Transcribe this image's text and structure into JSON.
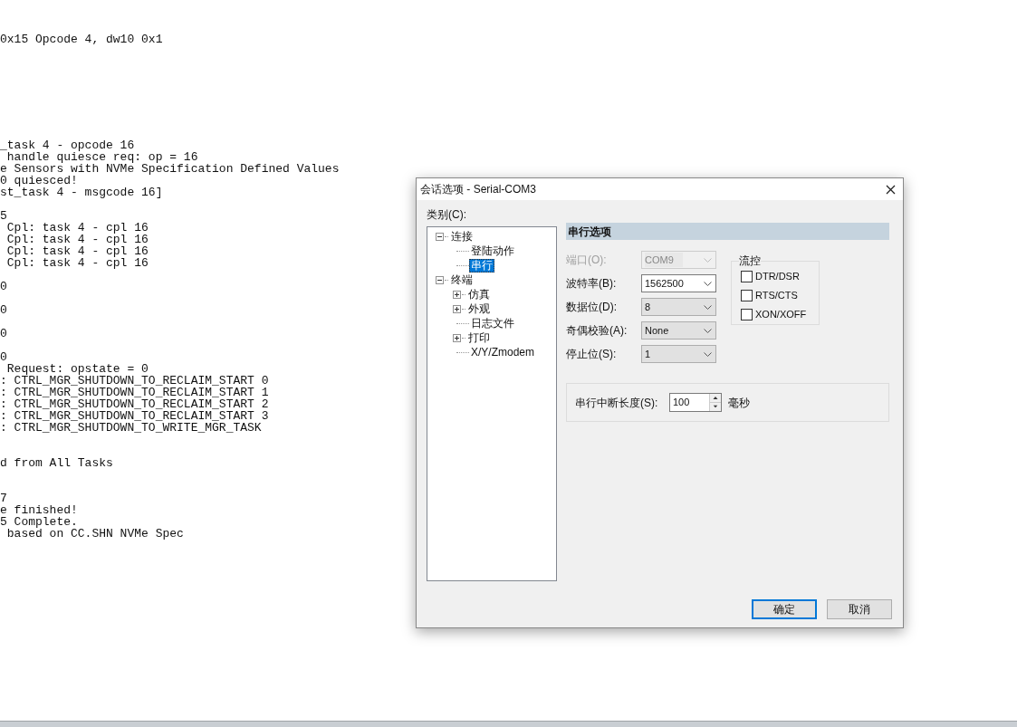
{
  "terminal": {
    "blocks": [
      {
        "lines": [
          "0x15 Opcode 4, dw10 0x1"
        ]
      },
      {
        "lines": [
          "_task 4 - opcode 16",
          " handle quiesce req: op = 16",
          "e Sensors with NVMe Specification Defined Values",
          "0 quiesced!",
          "st_task 4 - msgcode 16]"
        ]
      },
      {
        "lines": [
          "5",
          " Cpl: task 4 - cpl 16",
          " Cpl: task 4 - cpl 16",
          " Cpl: task 4 - cpl 16",
          " Cpl: task 4 - cpl 16"
        ]
      },
      {
        "lines": [
          "0"
        ]
      },
      {
        "lines": [
          "0"
        ]
      },
      {
        "lines": [
          "0"
        ]
      },
      {
        "lines": [
          "0",
          " Request: opstate = 0",
          ": CTRL_MGR_SHUTDOWN_TO_RECLAIM_START 0",
          ": CTRL_MGR_SHUTDOWN_TO_RECLAIM_START 1",
          ": CTRL_MGR_SHUTDOWN_TO_RECLAIM_START 2",
          ": CTRL_MGR_SHUTDOWN_TO_RECLAIM_START 3",
          ": CTRL_MGR_SHUTDOWN_TO_WRITE_MGR_TASK"
        ]
      },
      {
        "lines": [
          "d from All Tasks"
        ]
      },
      {
        "lines": [
          "7",
          "e finished!",
          "5 Complete.",
          " based on CC.SHN NVMe Spec"
        ]
      }
    ]
  },
  "dialog": {
    "title": "会话选项 - Serial-COM3",
    "category_label": "类别(C):",
    "tree": [
      {
        "label": "连接",
        "expanded": true,
        "selected": false,
        "children": [
          {
            "label": "登陆动作",
            "selected": false
          },
          {
            "label": "串行",
            "selected": true
          }
        ]
      },
      {
        "label": "终端",
        "expanded": true,
        "selected": false,
        "children": [
          {
            "label": "仿真",
            "expanded": false,
            "selected": false
          },
          {
            "label": "外观",
            "expanded": false,
            "selected": false
          },
          {
            "label": "日志文件",
            "selected": false
          },
          {
            "label": "打印",
            "expanded": false,
            "selected": false
          },
          {
            "label": "X/Y/Zmodem",
            "selected": false
          }
        ]
      }
    ],
    "section_title": "串行选项",
    "fields": [
      {
        "label": "端口(O):",
        "value": "COM9",
        "kind": "dropdown",
        "disabled": true
      },
      {
        "label": "波特率(B):",
        "value": "1562500",
        "kind": "combo",
        "disabled": false
      },
      {
        "label": "数据位(D):",
        "value": "8",
        "kind": "dropdown",
        "disabled": false
      },
      {
        "label": "奇偶校验(A):",
        "value": "None",
        "kind": "dropdown",
        "disabled": false
      },
      {
        "label": "停止位(S):",
        "value": "1",
        "kind": "dropdown",
        "disabled": false
      }
    ],
    "flow_control": {
      "title": "流控",
      "options": [
        {
          "label": "DTR/DSR",
          "checked": false
        },
        {
          "label": "RTS/CTS",
          "checked": false
        },
        {
          "label": "XON/XOFF",
          "checked": false
        }
      ]
    },
    "break_length": {
      "label": "串行中断长度(S):",
      "value": "100",
      "unit": "毫秒"
    },
    "buttons": [
      {
        "label": "确定",
        "default": true
      },
      {
        "label": "取消",
        "default": false
      }
    ]
  }
}
